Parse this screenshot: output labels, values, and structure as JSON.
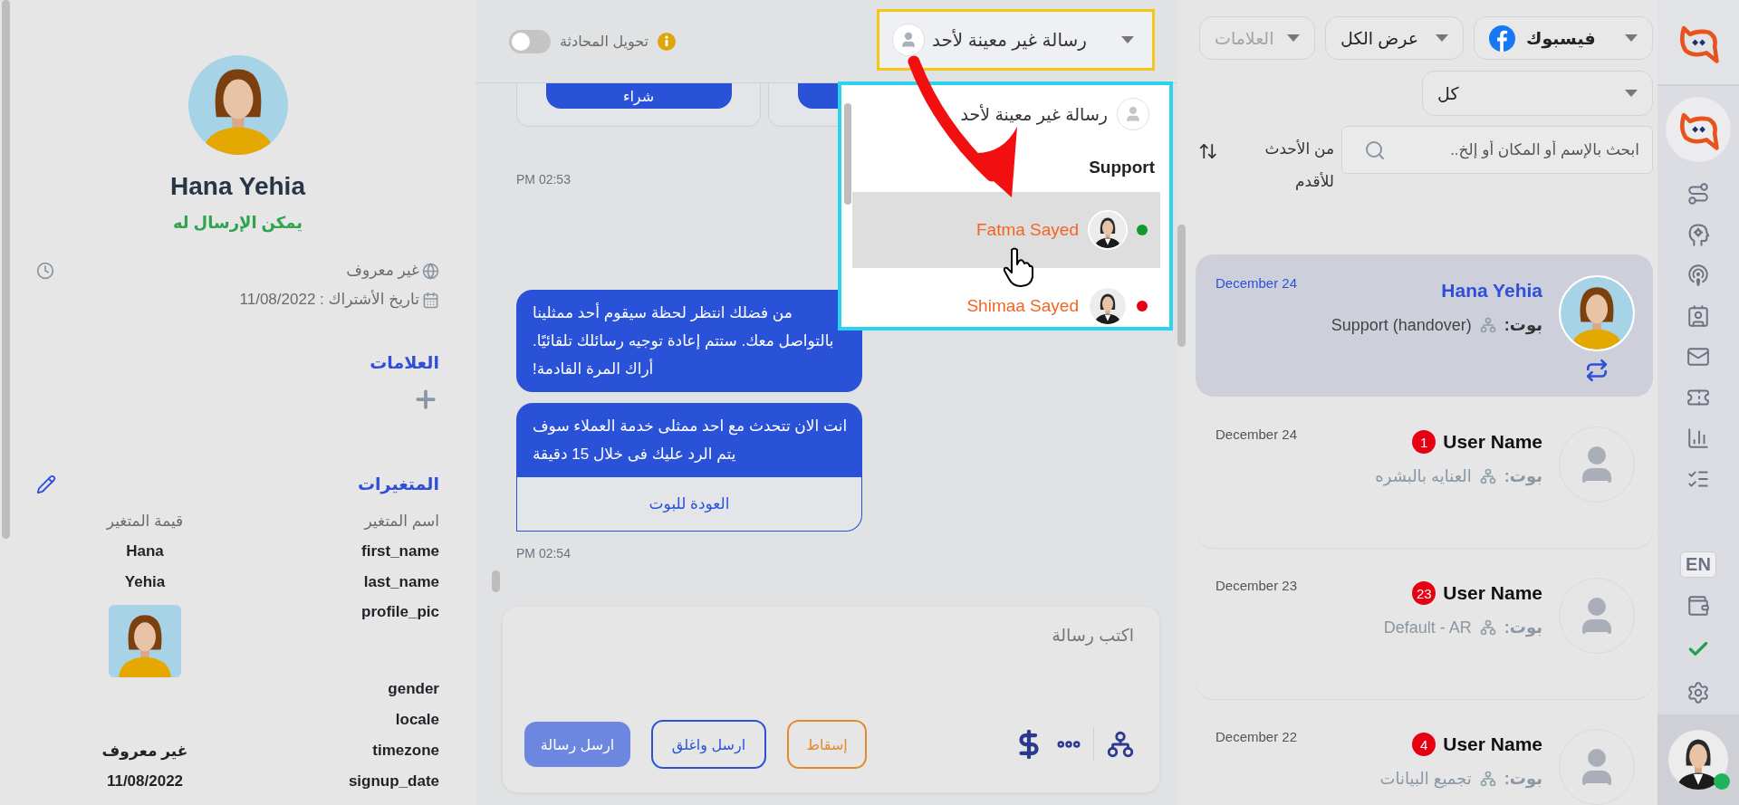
{
  "contact": {
    "name": "Hana Yehia",
    "status": "يمكن الإرسال له",
    "location": "غير معروف",
    "signup": "تاريخ الأشتراك : 11/08/2022",
    "tags_title": "العلامات",
    "variables_title": "المتغيرات",
    "variables_columns": [
      "اسم المتغير",
      "قيمة المتغير"
    ],
    "variables": [
      {
        "name": "first_name",
        "kind": "text",
        "value": "Hana"
      },
      {
        "name": "last_name",
        "kind": "text",
        "value": "Yehia"
      },
      {
        "name": "profile_pic",
        "kind": "image"
      },
      {
        "name": "gender",
        "kind": "empty"
      },
      {
        "name": "locale",
        "kind": "empty"
      },
      {
        "name": "timezone",
        "kind": "text",
        "value": "غير معروف"
      },
      {
        "name": "signup_date",
        "kind": "text",
        "value": "11/08/2022"
      }
    ]
  },
  "chat": {
    "transfer": {
      "label": "تحويل المحادثة",
      "on": false
    },
    "assignee": "رسالة غير معينة لأحد",
    "assign_menu": [
      {
        "kind": "unassigned",
        "label": "رسالة غير معينة لأحد",
        "selected": false
      },
      {
        "kind": "group",
        "label": "Support"
      },
      {
        "kind": "agent",
        "label": "Fatma Sayed",
        "selected": true,
        "color": "#119a2b"
      },
      {
        "kind": "agent",
        "label": "Shimaa Sayed",
        "selected": false,
        "color": "#e60012"
      }
    ],
    "timeline": [
      {
        "kind": "cards",
        "cards": [
          {
            "kind": "button",
            "button": "شراء"
          },
          {
            "kind": "covered"
          }
        ]
      },
      {
        "kind": "time",
        "text": "PM 02:53"
      },
      {
        "kind": "bubble",
        "text": "من فضلك انتظر لحظة سيقوم أحد ممثلينا بالتواصل معك. ستتم إعادة توجيه رسائلك تلقائيًا. أراك المرة القادمة!"
      },
      {
        "kind": "bubble",
        "text": "انت الان تتحدث مع احد ممثلى خدمة العملاء سوف يتم الرد عليك فى خلال 15 دقيقة",
        "button": "العودة للبوت"
      },
      {
        "kind": "time",
        "text": "PM 02:54"
      }
    ],
    "composer": {
      "placeholder": "اكتب رسالة",
      "buttons": [
        {
          "kind": "drop",
          "label": "إسقاط"
        },
        {
          "kind": "send_close",
          "label": "ارسل واغلق"
        },
        {
          "kind": "send",
          "label": "ارسل رسالة"
        }
      ]
    }
  },
  "conversations": {
    "filters": [
      {
        "kind": "channel",
        "label": "فيسبوك"
      },
      {
        "kind": "plain",
        "label": "عرض الكل"
      },
      {
        "kind": "tags",
        "placeholder": "العلامات"
      }
    ],
    "status_filter": "كل",
    "search": {
      "placeholder": "ابحث بالإسم أو المكان أو إلخ.."
    },
    "sort": "من الأحدث للأقدم",
    "items": [
      {
        "name": "Hana Yehia",
        "date": "December 24",
        "bot_label": "بوت:",
        "flow": "Support (handover)",
        "kind": "photo",
        "transfer": true,
        "selected": true
      },
      {
        "name": "User Name",
        "date": "December 24",
        "unread": "1",
        "bot_label": "بوت:",
        "flow": "العنايه بالبشره",
        "kind": "placeholder",
        "transfer": false,
        "selected": false
      },
      {
        "name": "User Name",
        "date": "December 23",
        "unread": "23",
        "bot_label": "بوت:",
        "flow": "Default - AR",
        "kind": "placeholder",
        "transfer": false,
        "selected": false
      },
      {
        "name": "User Name",
        "date": "December 22",
        "unread": "4",
        "bot_label": "بوت:",
        "flow": "تجميع البيانات",
        "kind": "placeholder",
        "transfer": false,
        "selected": false
      }
    ]
  },
  "nav": {
    "items": [
      {
        "kind": "route"
      },
      {
        "kind": "head"
      },
      {
        "kind": "broadcast"
      },
      {
        "kind": "contact"
      },
      {
        "kind": "mail"
      },
      {
        "kind": "ticket"
      },
      {
        "kind": "chart"
      },
      {
        "kind": "checklist"
      },
      {
        "kind": "language",
        "label": "EN",
        "selected": true
      },
      {
        "kind": "wallet"
      },
      {
        "kind": "check"
      },
      {
        "kind": "settings"
      }
    ],
    "agent_online": true
  }
}
